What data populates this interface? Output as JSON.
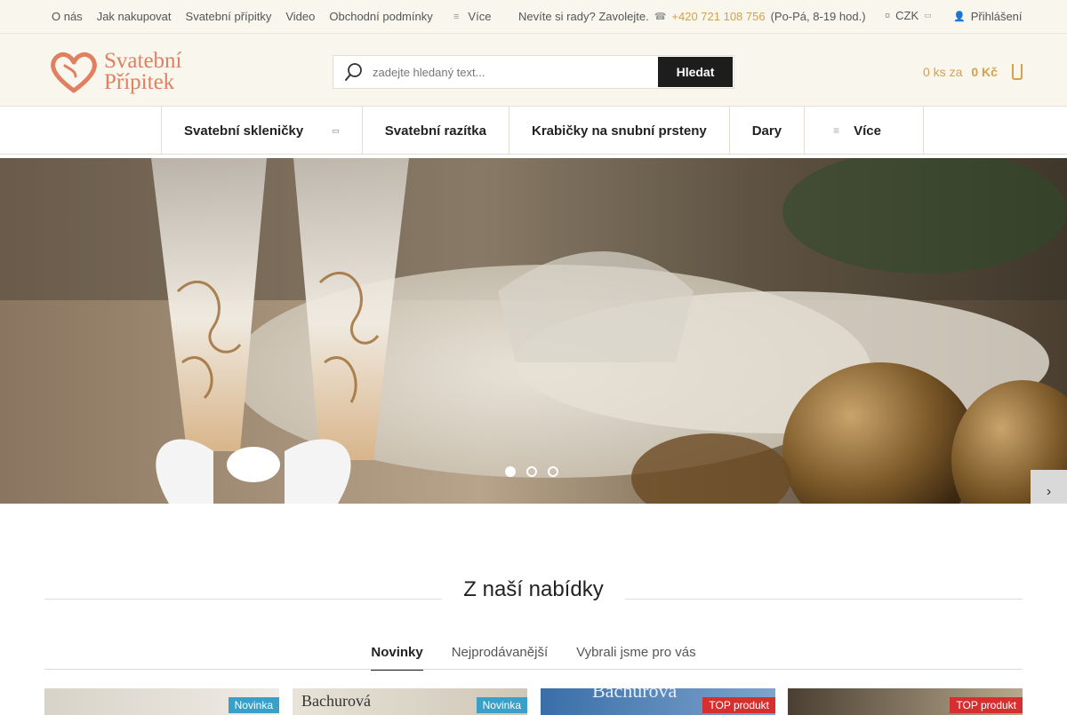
{
  "topbar": {
    "links": [
      "O nás",
      "Jak nakupovat",
      "Svatební přípitky",
      "Video",
      "Obchodní podmínky"
    ],
    "more_label": "Více",
    "help_text": "Nevíte si rady? Zavolejte.",
    "phone": "+420 721 108 756",
    "hours": "(Po-Pá, 8-19 hod.)",
    "currency": "CZK",
    "login": "Přihlášení"
  },
  "header": {
    "logo_line1": "Svatební",
    "logo_line2": "Přípitek",
    "search_placeholder": "zadejte hledaný text...",
    "search_button": "Hledat",
    "cart_count": "0 ks za",
    "cart_total": "0 Kč"
  },
  "nav": {
    "items": [
      "Svatební skleničky",
      "Svatební razítka",
      "Krabičky na snubní prsteny",
      "Dary"
    ],
    "more_label": "Více"
  },
  "section": {
    "title": "Z naší nabídky",
    "tabs": [
      "Novinky",
      "Nejprodávanější",
      "Vybrali jsme pro vás"
    ]
  },
  "products": [
    {
      "badge": "Novinka",
      "badge_type": "novinka"
    },
    {
      "badge": "Novinka",
      "badge_type": "novinka",
      "text": "Bachurová"
    },
    {
      "badge": "TOP produkt",
      "badge_type": "top",
      "text": "Bachurová"
    },
    {
      "badge": "TOP produkt",
      "badge_type": "top"
    }
  ],
  "colors": {
    "accent": "#d4a24a",
    "logo": "#e08060",
    "badge_new": "#3aa0c8",
    "badge_top": "#d62f2f"
  }
}
